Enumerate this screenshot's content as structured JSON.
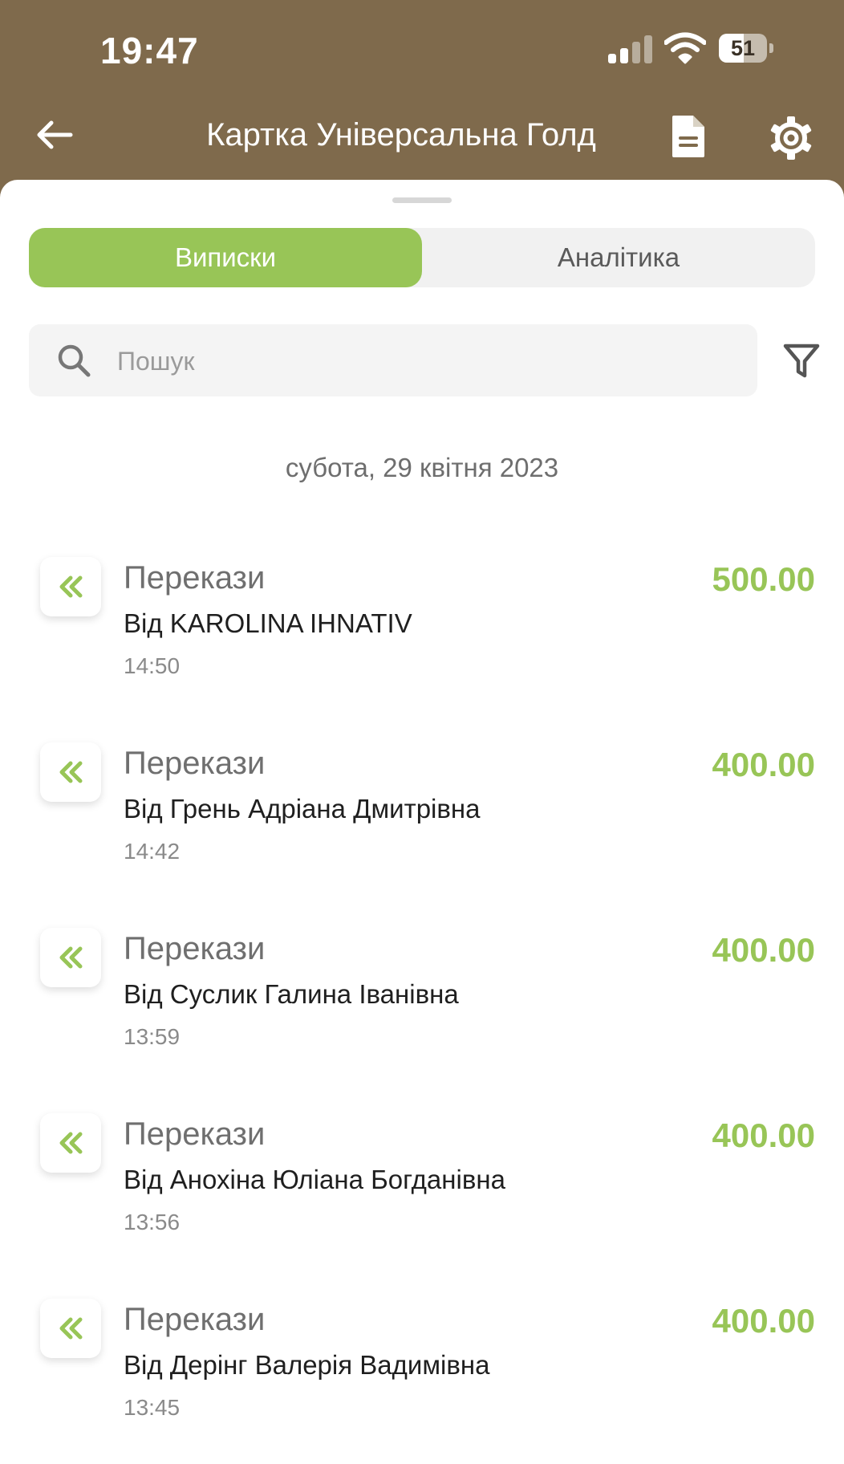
{
  "status_bar": {
    "time": "19:47",
    "battery_percent": "51",
    "battery_level": 0.51,
    "signal_bars_active": 2,
    "signal_bars_total": 4
  },
  "header": {
    "title": "Картка Універсальна Голд",
    "icons": [
      "arrow-left",
      "document",
      "gear"
    ]
  },
  "tabs": [
    {
      "label": "Виписки",
      "active": true
    },
    {
      "label": "Аналітика",
      "active": false
    }
  ],
  "search": {
    "placeholder": "Пошук",
    "value": ""
  },
  "date_group": "субота, 29 квітня 2023",
  "transactions": [
    {
      "category": "Перекази",
      "description": "Від KAROLINA IHNATIV",
      "time": "14:50",
      "amount": "500.00",
      "icon": "double-chevron-left"
    },
    {
      "category": "Перекази",
      "description": "Від Грень Адріана Дмитрівна",
      "time": "14:42",
      "amount": "400.00",
      "icon": "double-chevron-left"
    },
    {
      "category": "Перекази",
      "description": "Від Суслик Галина Іванівна",
      "time": "13:59",
      "amount": "400.00",
      "icon": "double-chevron-left"
    },
    {
      "category": "Перекази",
      "description": "Від Анохіна Юліана Богданівна",
      "time": "13:56",
      "amount": "400.00",
      "icon": "double-chevron-left"
    },
    {
      "category": "Перекази",
      "description": "Від Дерінг Валерія Вадимівна",
      "time": "13:45",
      "amount": "400.00",
      "icon": "double-chevron-left"
    }
  ],
  "colors": {
    "header_bg": "#7f6a4c",
    "accent": "#98c557",
    "sheet_bg": "#ffffff"
  }
}
